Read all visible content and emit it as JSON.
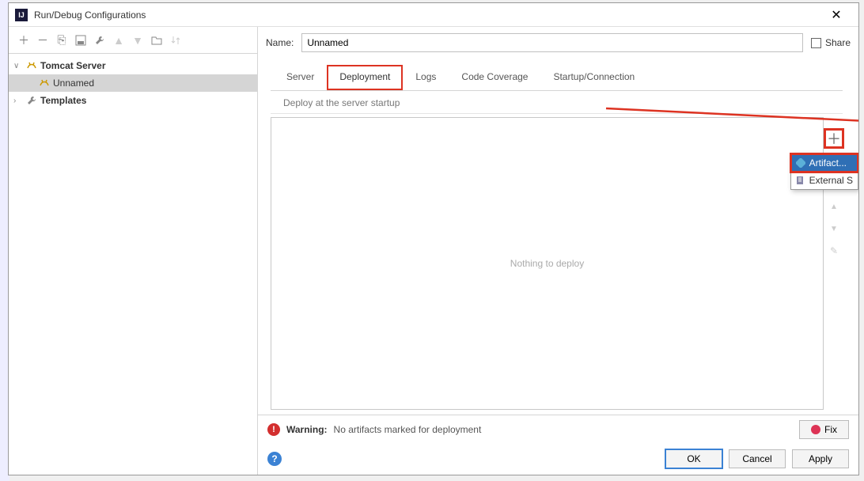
{
  "window": {
    "title": "Run/Debug Configurations",
    "close": "✕"
  },
  "toolbar": {
    "add": "＋",
    "remove": "－",
    "copy": "⎘",
    "save": "💾",
    "wrench": "🔧",
    "up": "▲",
    "down": "▼",
    "folder": "📁",
    "sort": "⇅"
  },
  "tree": {
    "server_group": "Tomcat Server",
    "config_name": "Unnamed",
    "templates": "Templates"
  },
  "form": {
    "name_label": "Name:",
    "name_value": "Unnamed",
    "share_label": "Share"
  },
  "tabs": [
    "Server",
    "Deployment",
    "Logs",
    "Code Coverage",
    "Startup/Connection"
  ],
  "deploy": {
    "section_label": "Deploy at the server startup",
    "empty": "Nothing to deploy"
  },
  "popup": {
    "artifact": "Artifact...",
    "external": "External S"
  },
  "right_tools": {
    "plus": "＋",
    "minus": "－",
    "up": "▲",
    "down": "▼",
    "edit": "✎"
  },
  "warning": {
    "label": "Warning:",
    "text": "No artifacts marked for deployment",
    "fix": "Fix"
  },
  "footer": {
    "ok": "OK",
    "cancel": "Cancel",
    "apply": "Apply"
  }
}
